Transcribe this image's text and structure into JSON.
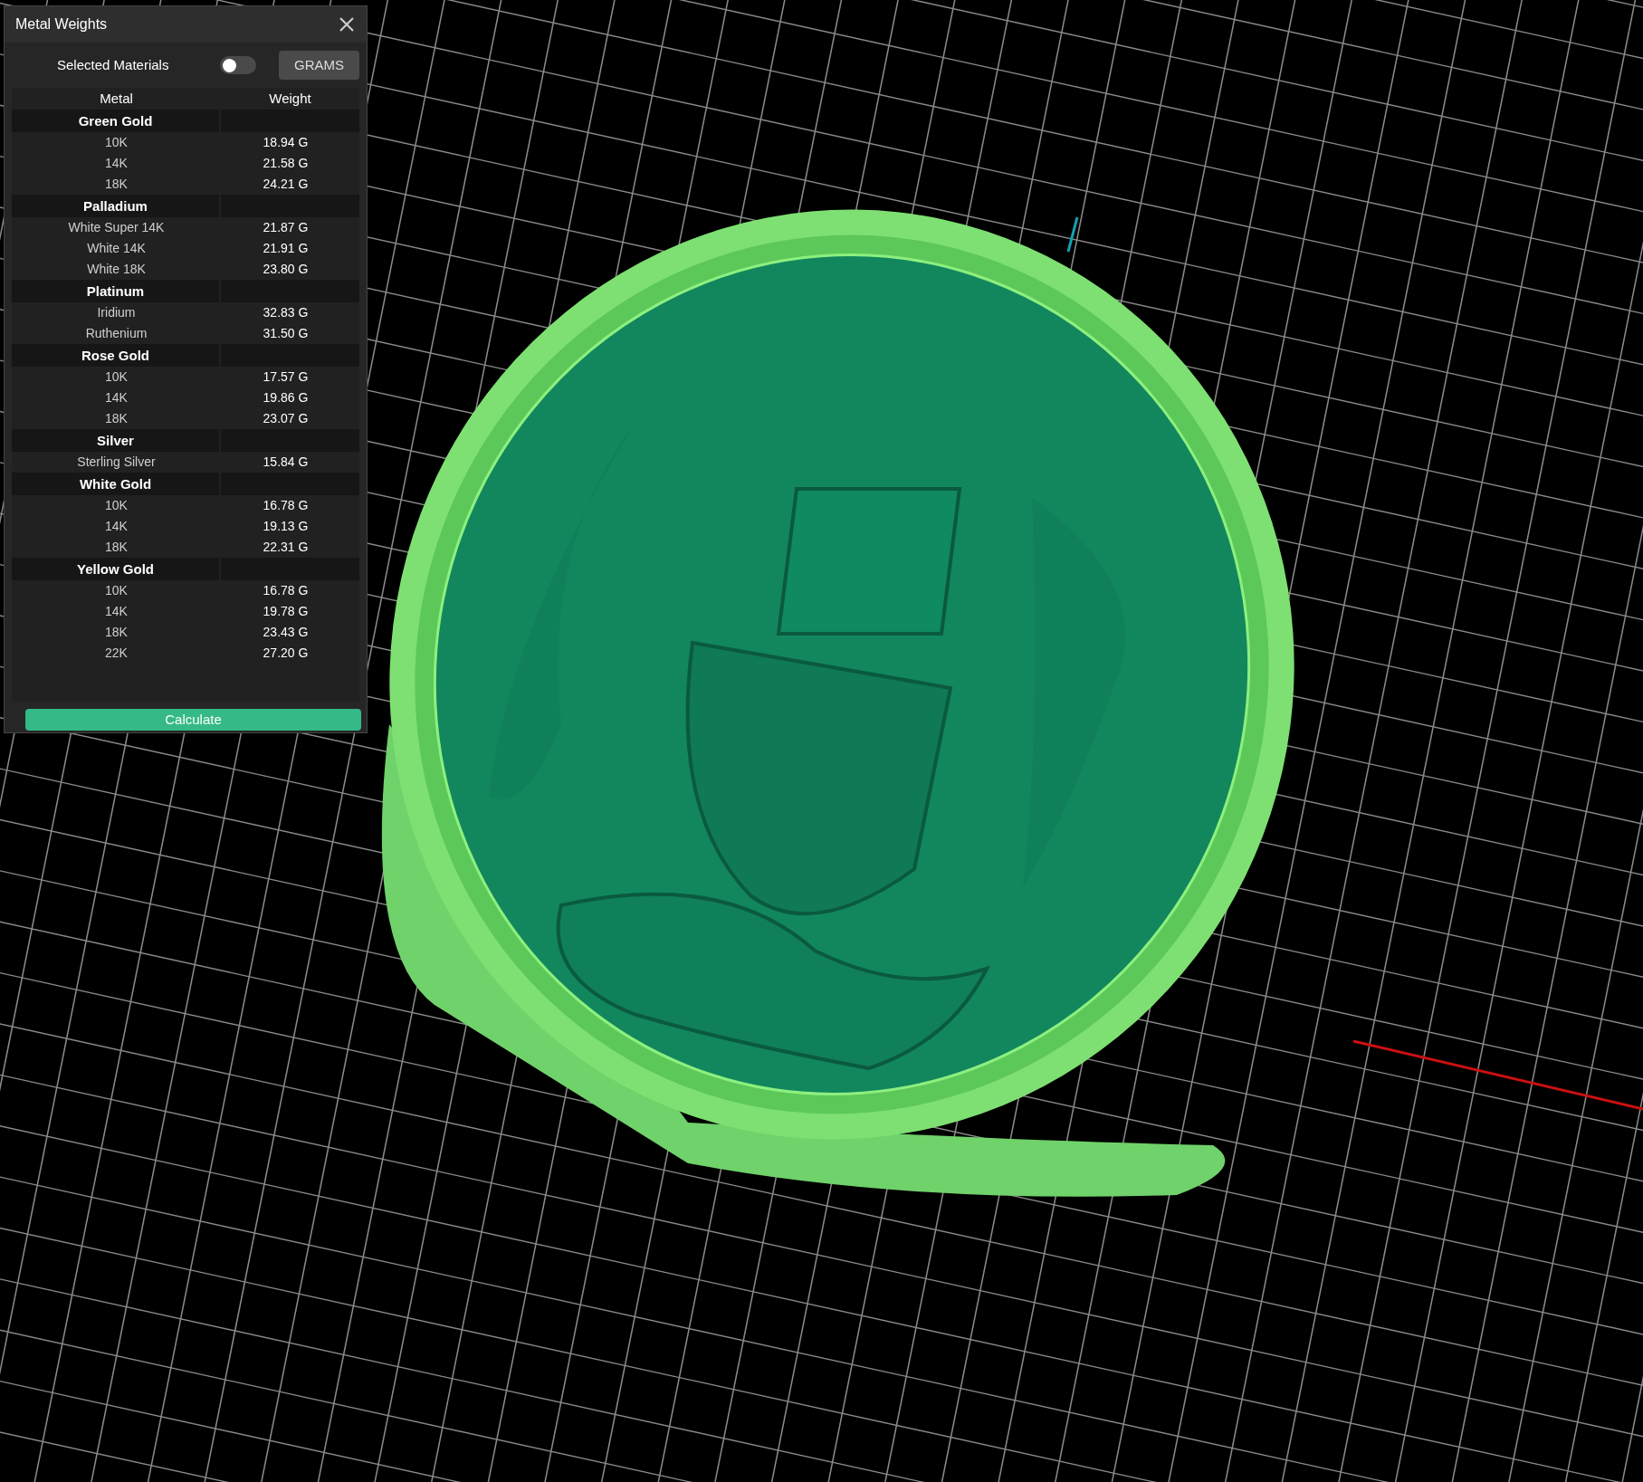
{
  "panel": {
    "title": "Metal Weights",
    "toggle": {
      "label": "Selected Materials",
      "on": false
    },
    "unit_button": "GRAMS",
    "columns": [
      "Metal",
      "Weight"
    ],
    "groups": [
      {
        "name": "Green Gold",
        "items": [
          {
            "name": "10K",
            "weight": "18.94 G"
          },
          {
            "name": "14K",
            "weight": "21.58 G"
          },
          {
            "name": "18K",
            "weight": "24.21 G"
          }
        ]
      },
      {
        "name": "Palladium",
        "items": [
          {
            "name": "White Super 14K",
            "weight": "21.87 G"
          },
          {
            "name": "White 14K",
            "weight": "21.91 G"
          },
          {
            "name": "White 18K",
            "weight": "23.80 G"
          }
        ]
      },
      {
        "name": "Platinum",
        "items": [
          {
            "name": "Iridium",
            "weight": "32.83 G"
          },
          {
            "name": "Ruthenium",
            "weight": "31.50 G"
          }
        ]
      },
      {
        "name": "Rose Gold",
        "items": [
          {
            "name": "10K",
            "weight": "17.57 G"
          },
          {
            "name": "14K",
            "weight": "19.86 G"
          },
          {
            "name": "18K",
            "weight": "23.07 G"
          }
        ]
      },
      {
        "name": "Silver",
        "items": [
          {
            "name": "Sterling Silver",
            "weight": "15.84 G"
          }
        ]
      },
      {
        "name": "White Gold",
        "items": [
          {
            "name": "10K",
            "weight": "16.78 G"
          },
          {
            "name": "14K",
            "weight": "19.13 G"
          },
          {
            "name": "18K",
            "weight": "22.31 G"
          }
        ]
      },
      {
        "name": "Yellow Gold",
        "items": [
          {
            "name": "10K",
            "weight": "16.78 G"
          },
          {
            "name": "14K",
            "weight": "19.78 G"
          },
          {
            "name": "18K",
            "weight": "23.43 G"
          },
          {
            "name": "22K",
            "weight": "27.20 G"
          }
        ]
      }
    ],
    "action_button": "Calculate"
  }
}
